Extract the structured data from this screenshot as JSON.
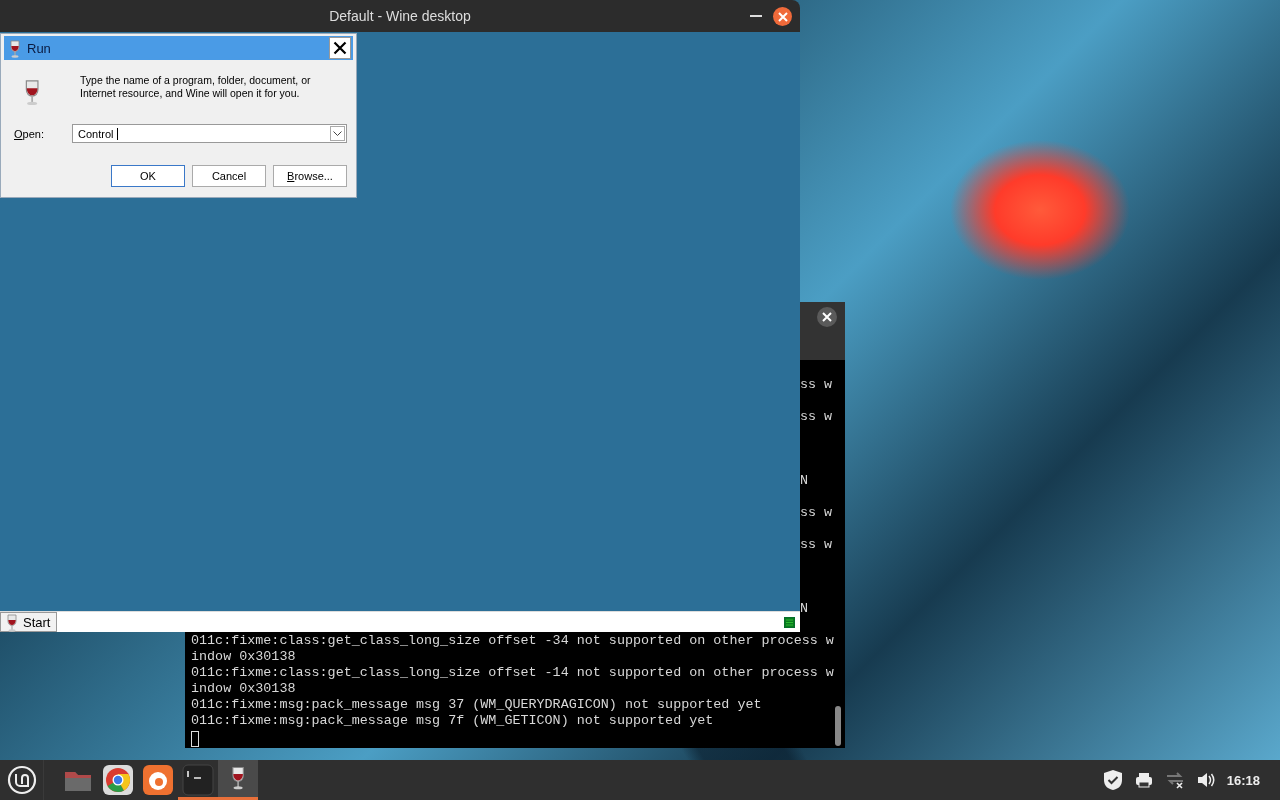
{
  "wine_desktop": {
    "title": "Default - Wine desktop",
    "start_button": "Start"
  },
  "run_dialog": {
    "title": "Run",
    "description": "Type the name of a program, folder, document, or\nInternet resource, and Wine will open it for you.",
    "open_label": "Open:",
    "open_value": "Control ",
    "buttons": [
      {
        "label": "OK",
        "default": true
      },
      {
        "label": "Cancel",
        "default": false
      },
      {
        "label": "Browse...",
        "default": false
      }
    ]
  },
  "terminal": {
    "hidden_line_ends": [
      "ss w",
      "ss w",
      "N",
      "ss w",
      "ss w",
      "N"
    ],
    "lines": [
      "011c:fixme:class:get_class_long_size offset -34 not supported on other process w",
      "indow 0x30138",
      "011c:fixme:class:get_class_long_size offset -14 not supported on other process w",
      "indow 0x30138",
      "011c:fixme:msg:pack_message msg 37 (WM_QUERYDRAGICON) not supported yet",
      "011c:fixme:msg:pack_message msg 7f (WM_GETICON) not supported yet"
    ]
  },
  "taskbar": {
    "launchers": [
      {
        "kind": "folder",
        "running": false,
        "focused": false
      },
      {
        "kind": "browser",
        "running": false,
        "focused": false
      },
      {
        "kind": "firefox",
        "running": false,
        "focused": false
      },
      {
        "kind": "terminal",
        "running": true,
        "focused": false
      },
      {
        "kind": "wine",
        "running": true,
        "focused": true
      }
    ],
    "clock": "16:18"
  }
}
